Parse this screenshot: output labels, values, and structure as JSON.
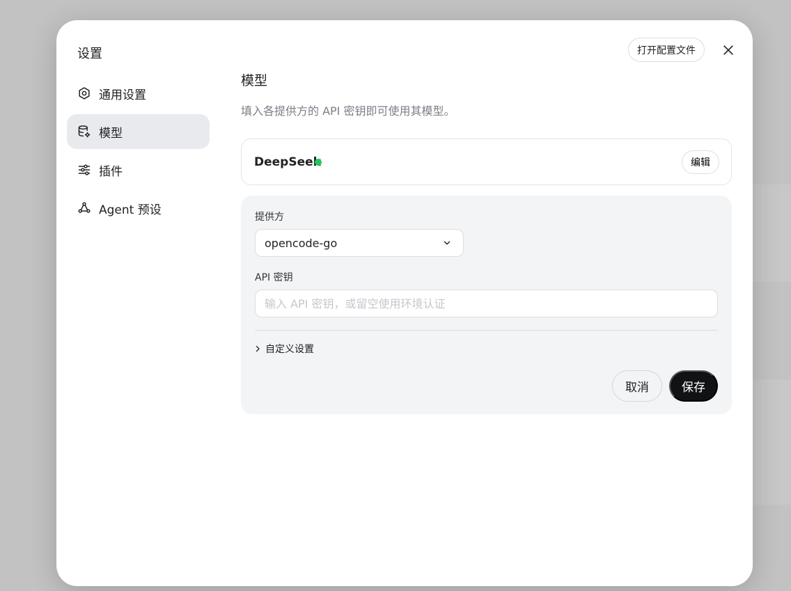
{
  "dialog": {
    "title": "设置",
    "open_config_label": "打开配置文件"
  },
  "nav": {
    "items": [
      {
        "label": "通用设置",
        "icon": "gear-icon"
      },
      {
        "label": "模型",
        "icon": "database-gear-icon",
        "active": true
      },
      {
        "label": "插件",
        "icon": "sliders-icon"
      },
      {
        "label": "Agent 预设",
        "icon": "agent-network-icon"
      }
    ]
  },
  "main": {
    "title": "模型",
    "description": "填入各提供方的 API 密钥即可使用其模型。",
    "provider_card": {
      "name": "DeepSeek",
      "status": "active",
      "status_color": "#22c55e",
      "edit_label": "编辑"
    },
    "form": {
      "provider_label": "提供方",
      "provider_value": "opencode-go",
      "api_key_label": "API 密钥",
      "api_key_placeholder": "输入 API 密钥，或留空使用环境认证",
      "api_key_value": "",
      "custom_settings_label": "自定义设置",
      "cancel_label": "取消",
      "save_label": "保存"
    }
  },
  "colors": {
    "accent_dark": "#111214",
    "nav_active_bg": "#e8eaee",
    "panel_bg": "#f3f4f6"
  }
}
